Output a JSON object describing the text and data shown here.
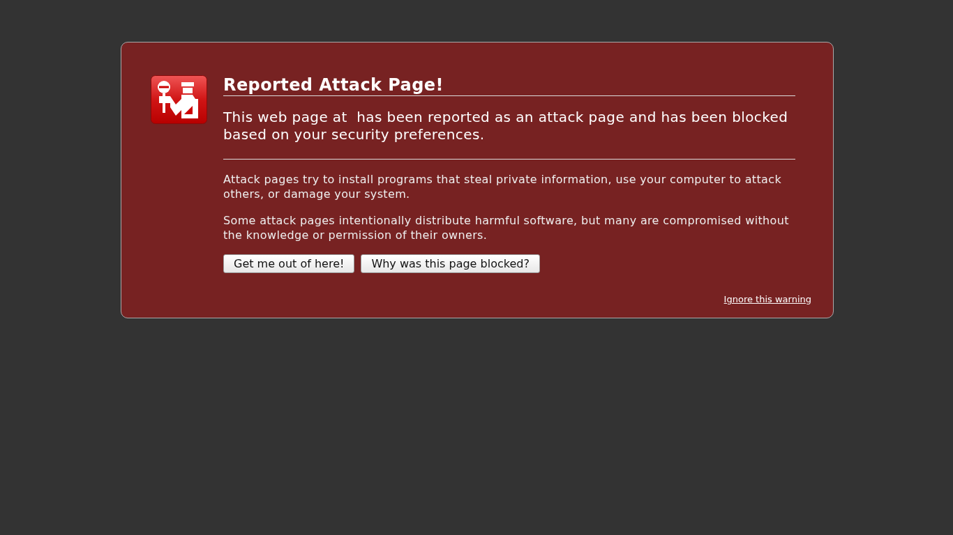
{
  "title": "Reported Attack Page!",
  "short_description": "This web page at  has been reported as an attack page and has been blocked based on your security preferences.",
  "long_description": [
    "Attack pages try to install programs that steal private information, use your computer to attack others, or damage your system.",
    "Some attack pages intentionally distribute harmful software, but many are compromised without the knowledge or permission of their owners."
  ],
  "buttons": [
    "Get me out of here!",
    "Why was this page blocked?"
  ],
  "ignore_link": "Ignore this warning"
}
